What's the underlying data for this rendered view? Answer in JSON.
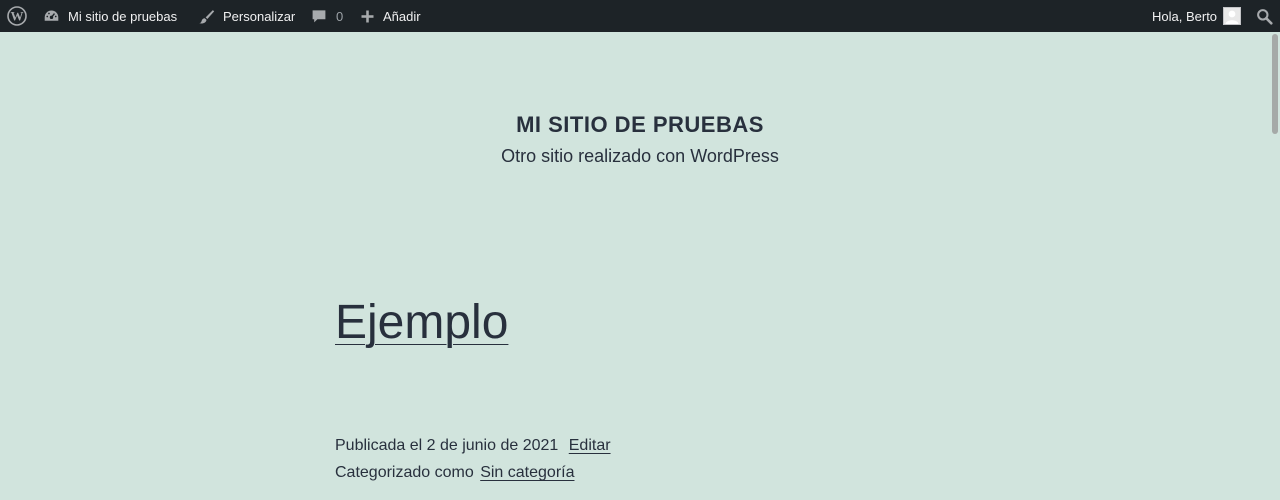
{
  "adminbar": {
    "wp_logo": "wordpress-logo-icon",
    "site_name": "Mi sitio de pruebas",
    "customize": "Personalizar",
    "comments_count": "0",
    "add_new": "Añadir",
    "greeting": "Hola, Berto",
    "bg_color": "#1d2327"
  },
  "site": {
    "title": "MI SITIO DE PRUEBAS",
    "description": "Otro sitio realizado con WordPress",
    "bg_color": "#d1e4dd"
  },
  "post": {
    "title": "Ejemplo",
    "published": "Publicada el 2 de junio de 2021",
    "edit_label": "Editar",
    "categorized_prefix": "Categorizado como",
    "category": "Sin categoría"
  }
}
